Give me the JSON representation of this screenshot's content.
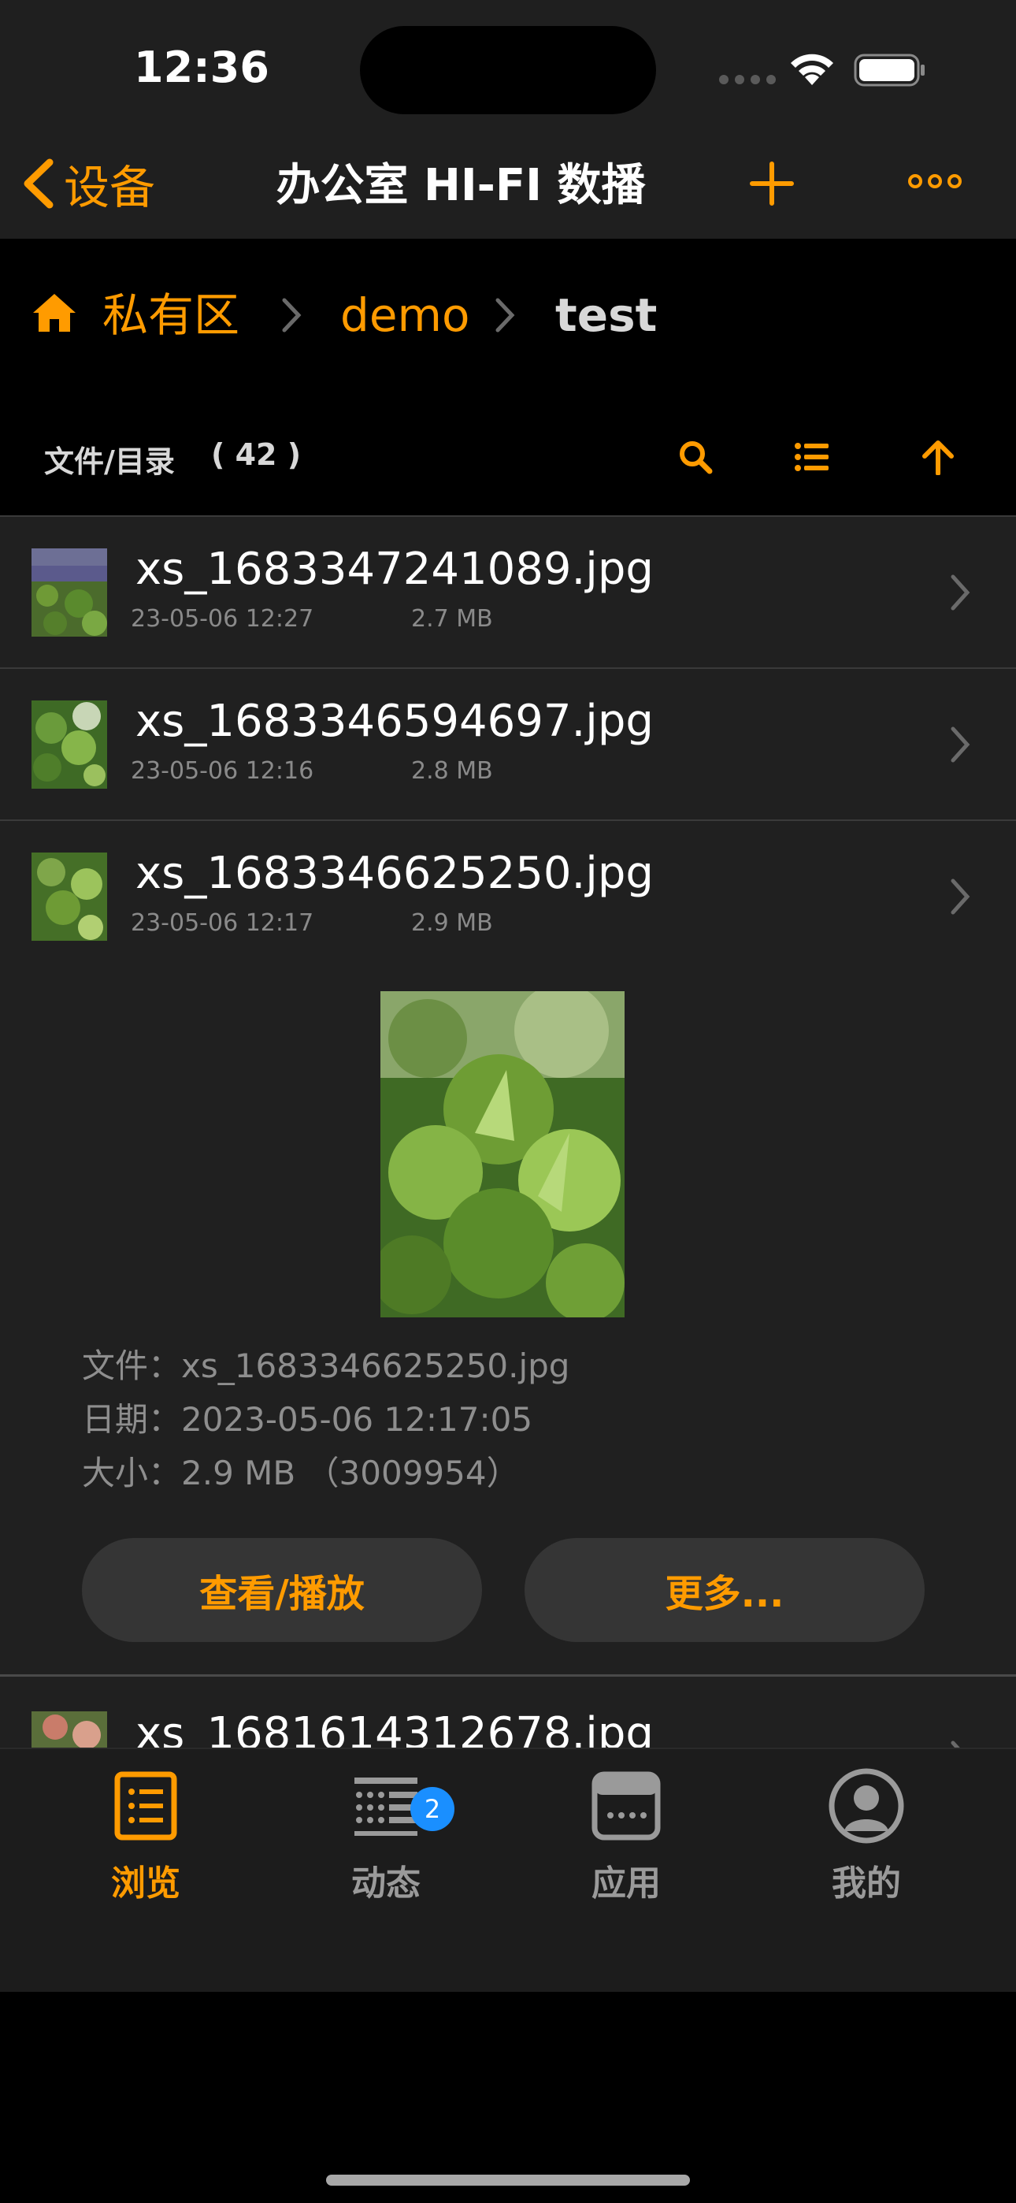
{
  "status": {
    "time": "12:36"
  },
  "nav": {
    "back_label": "设备",
    "title": "办公室 HI-FI 数播"
  },
  "breadcrumb": {
    "items": [
      "私有区",
      "demo",
      "test"
    ]
  },
  "list_header": {
    "label": "文件/目录",
    "count": "( 42 )"
  },
  "files": [
    {
      "name": "xs_1683347241089.jpg",
      "date": "23-05-06 12:27",
      "size": "2.7 MB"
    },
    {
      "name": "xs_1683346594697.jpg",
      "date": "23-05-06 12:16",
      "size": "2.8 MB"
    },
    {
      "name": "xs_1683346625250.jpg",
      "date": "23-05-06 12:17",
      "size": "2.9 MB"
    },
    {
      "name": "xs_1681614312678.jpg"
    }
  ],
  "detail": {
    "file_line": "文件：xs_1683346625250.jpg",
    "date_line": "日期：2023-05-06 12:17:05",
    "size_line": "大小：2.9 MB （3009954）",
    "view_button": "查看/播放",
    "more_button": "更多..."
  },
  "tabs": [
    {
      "label": "浏览",
      "icon": "browse-icon",
      "active": true
    },
    {
      "label": "动态",
      "icon": "activity-icon",
      "badge": "2"
    },
    {
      "label": "应用",
      "icon": "apps-icon"
    },
    {
      "label": "我的",
      "icon": "profile-icon"
    }
  ],
  "colors": {
    "accent": "#ff9b00",
    "badge": "#1a8fff",
    "background": "#202020",
    "nav": "#1f1f1f"
  }
}
